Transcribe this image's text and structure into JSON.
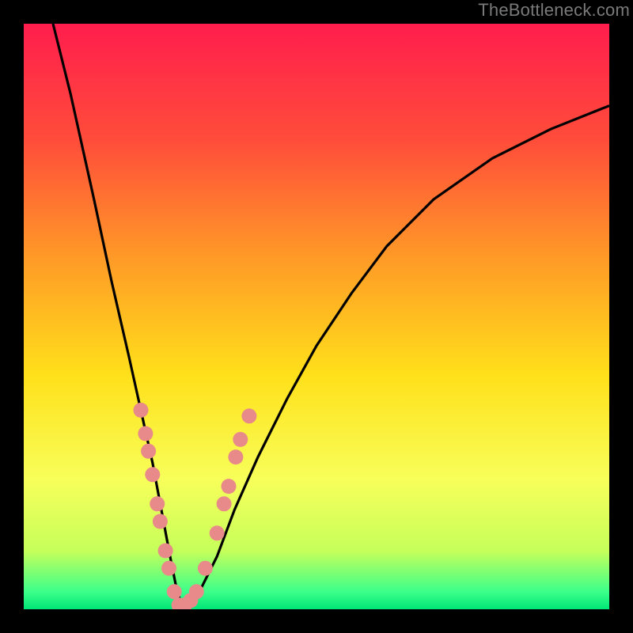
{
  "watermark": "TheBottleneck.com",
  "chart_data": {
    "type": "line",
    "title": "",
    "xlabel": "",
    "ylabel": "",
    "xlim": [
      0,
      100
    ],
    "ylim": [
      0,
      100
    ],
    "grid": false,
    "legend": false,
    "series": [
      {
        "name": "bottleneck-curve",
        "x": [
          5,
          8,
          12,
          15,
          18,
          20,
          22,
          23.5,
          25,
          26,
          27,
          28,
          30,
          33,
          36,
          40,
          45,
          50,
          56,
          62,
          70,
          80,
          90,
          100
        ],
        "y": [
          100,
          88,
          70,
          56,
          43,
          34,
          25,
          17,
          9,
          4,
          0.5,
          0.5,
          3,
          9,
          17,
          26,
          36,
          45,
          54,
          62,
          70,
          77,
          82,
          86
        ]
      }
    ],
    "markers": {
      "name": "highlight-points",
      "points": [
        {
          "x": 20.0,
          "y": 34
        },
        {
          "x": 20.8,
          "y": 30
        },
        {
          "x": 21.3,
          "y": 27
        },
        {
          "x": 22.0,
          "y": 23
        },
        {
          "x": 22.8,
          "y": 18
        },
        {
          "x": 23.3,
          "y": 15
        },
        {
          "x": 24.2,
          "y": 10
        },
        {
          "x": 24.8,
          "y": 7
        },
        {
          "x": 25.7,
          "y": 3
        },
        {
          "x": 26.5,
          "y": 0.7
        },
        {
          "x": 27.5,
          "y": 0.7
        },
        {
          "x": 28.5,
          "y": 1.5
        },
        {
          "x": 29.5,
          "y": 3
        },
        {
          "x": 31.0,
          "y": 7
        },
        {
          "x": 33.0,
          "y": 13
        },
        {
          "x": 34.2,
          "y": 18
        },
        {
          "x": 35.0,
          "y": 21
        },
        {
          "x": 36.2,
          "y": 26
        },
        {
          "x": 37.0,
          "y": 29
        },
        {
          "x": 38.5,
          "y": 33
        }
      ]
    },
    "colors": {
      "curve": "#000000",
      "marker": "#e98a8a",
      "gradient_top": "#ff1d4d",
      "gradient_mid": "#ffe01a",
      "gradient_bottom": "#00e676",
      "frame": "#000000"
    }
  }
}
